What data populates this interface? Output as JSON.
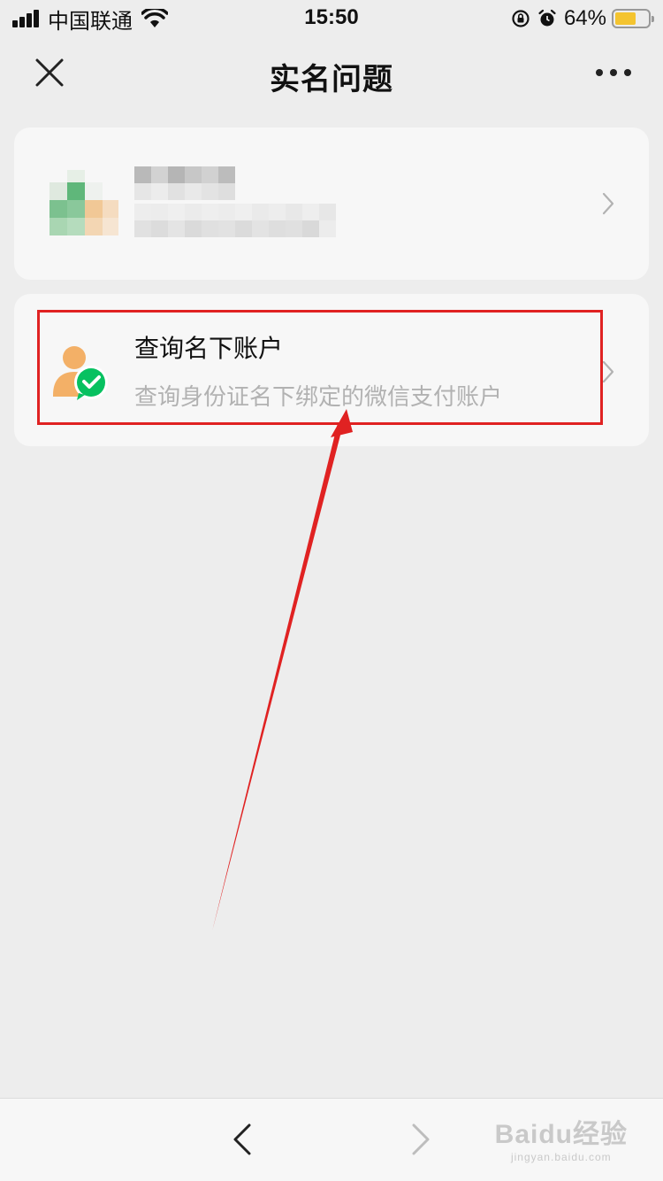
{
  "status_bar": {
    "carrier": "中国联通",
    "time": "15:50",
    "battery_percent": "64%",
    "battery_level": 0.64,
    "icons": [
      "signal-icon",
      "wifi-icon",
      "rotation-lock-icon",
      "alarm-icon",
      "battery-icon"
    ]
  },
  "nav": {
    "title": "实名问题",
    "close_icon": "close-icon",
    "more_icon": "more-icon"
  },
  "cards": {
    "card1": {
      "note": "",
      "icon": "blurred-avatar"
    },
    "card2": {
      "title": "查询名下账户",
      "subtitle": "查询身份证名下绑定的微信支付账户",
      "icon": "person-check-icon"
    }
  },
  "colors": {
    "accent_green": "#07c160",
    "annotation_red": "#e02222",
    "person_orange": "#f3b067"
  },
  "bottom_bar": {
    "back_icon": "chevron-left-icon",
    "forward_icon": "chevron-right-icon"
  },
  "watermark": {
    "main": "Baidu经验",
    "sub": "jingyan.baidu.com"
  }
}
